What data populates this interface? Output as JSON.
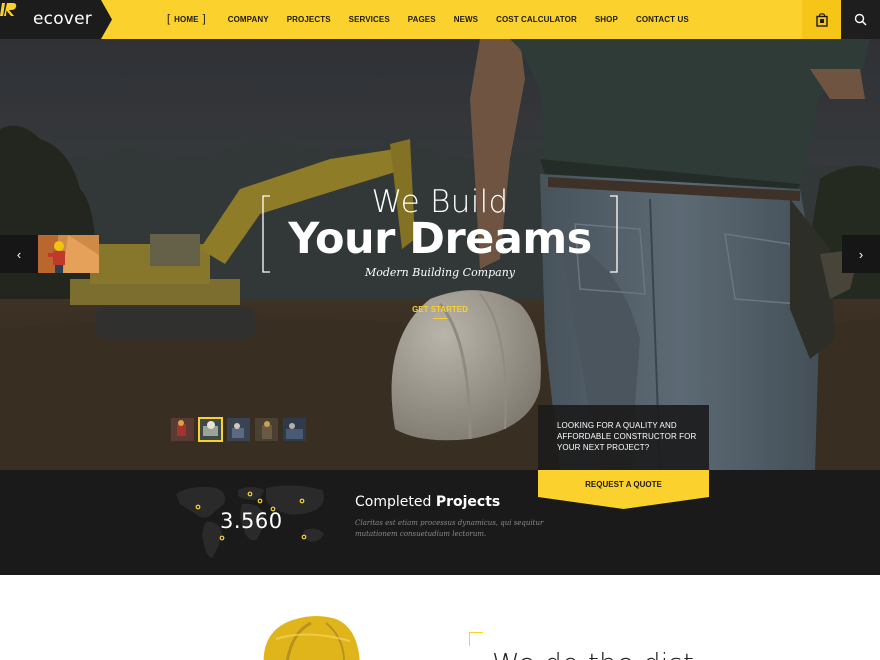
{
  "brand": {
    "logo_text": "ecover"
  },
  "nav": {
    "items": [
      {
        "label": "HOME",
        "active": true
      },
      {
        "label": "COMPANY"
      },
      {
        "label": "PROJECTS"
      },
      {
        "label": "SERVICES"
      },
      {
        "label": "PAGES"
      },
      {
        "label": "NEWS"
      },
      {
        "label": "COST CALCULATOR"
      },
      {
        "label": "SHOP"
      },
      {
        "label": "CONTACT US"
      }
    ],
    "active_bracket_open": "[",
    "active_bracket_close": "]",
    "icons": [
      "shopping-bag-icon",
      "search-icon"
    ]
  },
  "hero": {
    "line1": "We Build",
    "line2": "Your Dreams",
    "subtitle": "Modern Building Company",
    "cta": "GET STARTED",
    "prev_arrow": "‹",
    "next_arrow": "›",
    "slide_count": 5,
    "active_slide": 2,
    "quote_prompt": "LOOKING FOR A QUALITY AND AFFORDABLE CONSTRUCTOR FOR YOUR NEXT PROJECT?",
    "quote_button": "REQUEST A QUOTE"
  },
  "stats": {
    "counter": "3.560",
    "title_light": "Completed",
    "title_bold": "Projects",
    "description": "Claritas est etiam processus dynamicus, qui sequitur mutationem consuetudium lectorum."
  },
  "section": {
    "heading": "We do the dist"
  },
  "colors": {
    "accent": "#fbd12e",
    "dark": "#1a1a1a"
  }
}
